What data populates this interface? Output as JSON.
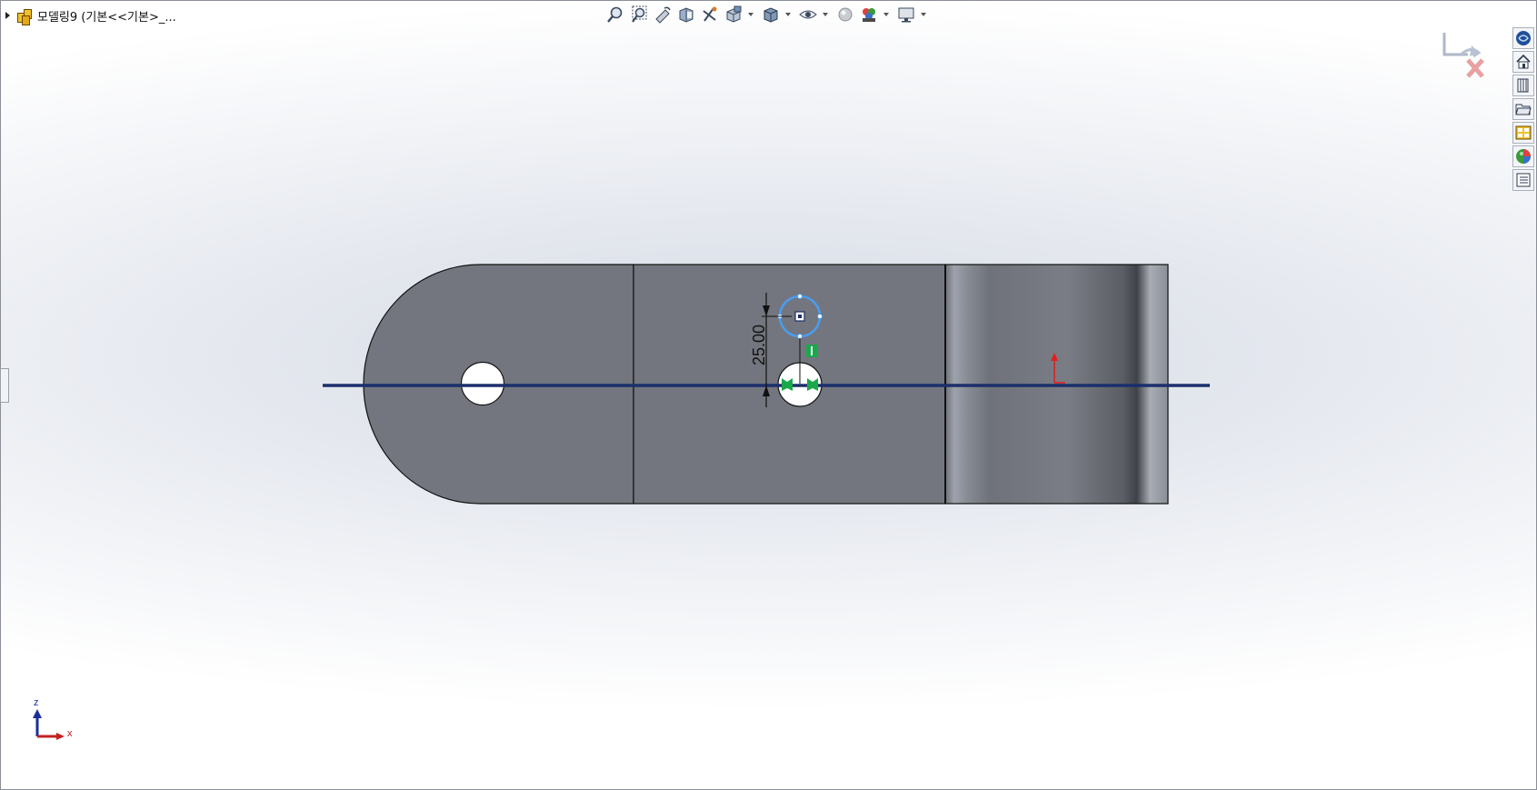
{
  "tree": {
    "document_name": "모델링9  (기본<<기본>_..."
  },
  "sketch": {
    "dimension_value": "25.00"
  },
  "triad": {
    "z_label": "z",
    "x_label": "x"
  },
  "heads_up_toolbar": {
    "icons": [
      "zoom-to-fit-icon",
      "zoom-to-area-icon",
      "previous-view-icon",
      "section-view-icon",
      "dynamic-annotation-view-icon",
      "view-orientation-icon",
      "display-style-icon",
      "hide-show-items-icon",
      "edit-appearance-icon",
      "apply-scene-icon",
      "view-settings-icon"
    ]
  },
  "task_pane": {
    "icons": [
      "solidworks-resources-icon",
      "design-library-icon",
      "file-explorer-icon",
      "view-palette-icon",
      "appearances-scenes-icon",
      "custom-properties-icon"
    ]
  },
  "colors": {
    "part_face": "#73767e",
    "selected_circle": "#4a9cf0",
    "centerline": "#1b2f6b",
    "relation_green": "#1aa84a"
  }
}
